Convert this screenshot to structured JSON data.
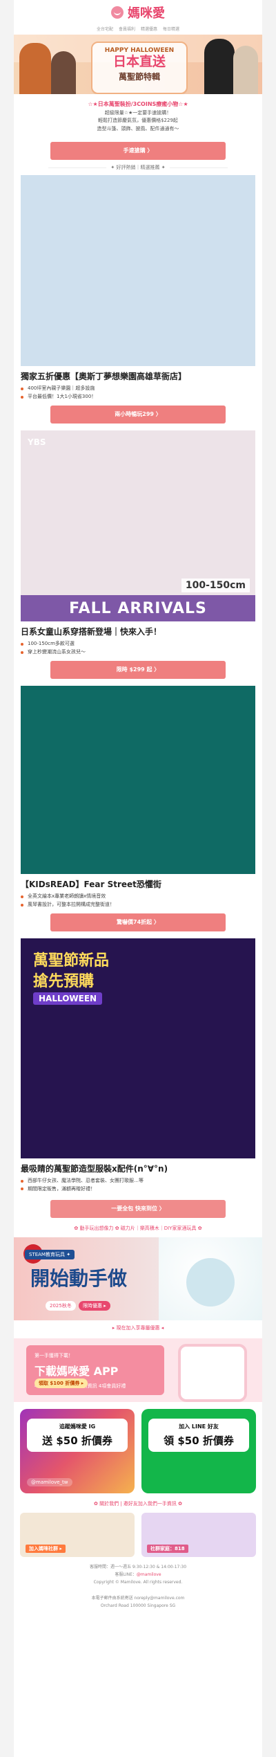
{
  "brand": {
    "name": "媽咪愛",
    "nav": [
      "全台宅配",
      "會員福利",
      "精選優惠",
      "每日精選"
    ]
  },
  "hero": {
    "line1": "HAPPY HALLOWEEN",
    "line2": "日本直送",
    "line3": "萬聖節特輯"
  },
  "intro": {
    "headline": "☆★日本萬聖裝扮/3COINS療癒小物☆★",
    "line1": "超級限量☆★一定要手速搶購！",
    "line2": "輕鬆打造節慶氣氛，優惠價格$229起",
    "line3": "造型斗篷、頭飾、披風、配件通通有～",
    "button": "手速搶購 〉"
  },
  "sub1": "✦ 好評熱銷｜精選推薦 ✦",
  "s1": {
    "title": "獨家五折優惠【奧斯丁夢想樂園高雄草衙店】",
    "bullets": [
      "400坪室內親子樂園｜超多設施",
      "平台最低價！1大1小現省300！"
    ],
    "button": "兩小時暢玩299 〉"
  },
  "s2": {
    "tag": "YBS",
    "size": "100-150cm",
    "banner": "FALL ARRIVALS",
    "title": "日系女童山系穿搭新登場｜快來入手！",
    "bullets": [
      "100-150cm多款可選",
      "穿上秒變潮流山系女孩兒～"
    ],
    "button": "限時 $299 起 〉"
  },
  "s3": {
    "title": "【KIDsREAD】Fear Street恐懼街",
    "bullets": [
      "全英文繪本x專業老師朗讀x情境音效",
      "風琴書設計，可整本拉開構成完整街道！"
    ],
    "button": "驚嚇價74折起 〉"
  },
  "s4": {
    "banner1": "萬聖節新品",
    "banner2": "搶先預購",
    "banner3": "HALLOWEEN",
    "title": "最吸睛的萬聖節造型服裝x配件(n°∀°n)",
    "bullets": [
      "西部牛仔女孩、魔法學院、忍者套裝、女團打歌服…等",
      "期間限定販售，滿額再贈好禮！"
    ],
    "button": "一要全包 快來到位 〉"
  },
  "strip_title": "✿ 動手玩出想像力 ✿ 磁力片｜樂高積木｜DIY家家酒玩具 ✿",
  "steam": {
    "badge": "CAN",
    "tagline": "STEAM教育玩具 ✦",
    "big": "開始動手做",
    "mini": "2025秋冬",
    "cta": "限時優惠 ▸"
  },
  "smallcta": "▸ 現在加入享專屬優惠 ◂",
  "app": {
    "l1": "第一手獲得下載！",
    "l2": "下載媽咪愛 APP",
    "l3": "4項全新功能 第一手最新資訊 4項會員好禮",
    "pill": "領取 $100 折價券 ▸"
  },
  "promo": {
    "ig_a": "追蹤媽咪愛 IG",
    "ig_b": "送 $50 折價券",
    "ig_handle": "@mamilove_tw",
    "line_a": "加入 LINE 好友",
    "line_b": "領 $50 折價券"
  },
  "share": "✿ 關於我們 | 邀好友加入我們一手資訊 ✿",
  "cards2": {
    "left": "加入媽咪社群 ▸",
    "right": "社群家庭：818"
  },
  "footer": {
    "line1": "客服時間：週一～週五 9:30-12:30 & 14:00-17:30",
    "line2": "客服LINE：@mamilove",
    "link": "@mamilove",
    "line3": "Copyright © Mamilove. All rights reserved.",
    "line4": "本電子郵件由系統寄送 noreply@mamilove.com",
    "line5": "Orchard Road 100000 Singapore SG"
  }
}
